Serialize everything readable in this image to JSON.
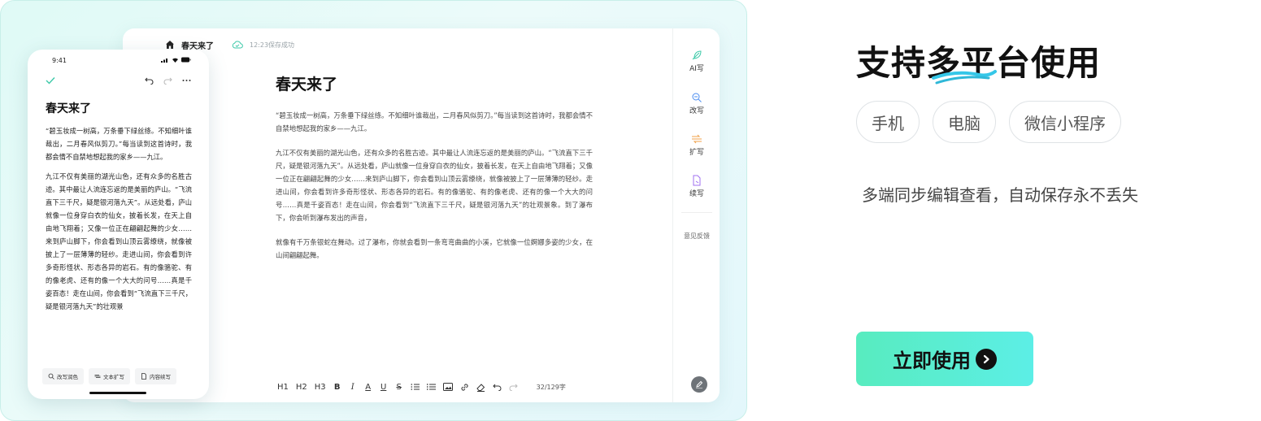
{
  "desktop": {
    "doc_name": "春天来了",
    "save_status": "12:23保存成功",
    "title": "春天来了",
    "paragraphs": [
      "“碧玉妆成一树高，万条垂下绿丝绦。不知细叶谁裁出，二月春风似剪刀。”每当读到这首诗时，我都会情不自禁地想起我的家乡——九江。",
      "九江不仅有美丽的湖光山色，还有众多的名胜古迹。其中最让人流连忘返的是美丽的庐山。“飞流直下三千尺，疑是银河落九天”。从远处看，庐山就像一位身穿白衣的仙女，披着长发，在天上自由地飞翔着；又像一位正在翩翩起舞的少女……来到庐山脚下，你会看到山顶云雾缭绕，就像被披上了一层薄薄的轻纱。走进山间，你会看到许多奇形怪状、形态各异的岩石。有的像骆驼、有的像老虎、还有的像一个大大的问号……真是千姿百态！走在山间，你会看到“飞流直下三千尺，疑是银河落九天”的壮观景象。到了瀑布下，你会听到瀑布发出的声音，",
      "就像有千万条银蛇在舞动。过了瀑布，你就会看到一条弯弯曲曲的小溪，它就像一位婀娜多姿的少女，在山间翩翩起舞。"
    ],
    "toolbar": [
      "H1",
      "H2",
      "H3",
      "B",
      "I",
      "A",
      "U",
      "S"
    ],
    "word_count": "32/129字",
    "rail": {
      "ai_write": "AI写",
      "rewrite": "改写",
      "expand": "扩写",
      "continue": "续写",
      "feedback": "意见反馈"
    }
  },
  "phone": {
    "time": "9:41",
    "title": "春天来了",
    "paragraphs": [
      "“碧玉妆成一树高，万条垂下绿丝绦。不知细叶谁裁出，二月春风似剪刀。”每当读到这首诗时，我都会情不自禁地想起我的家乡——九江。",
      "九江不仅有美丽的湖光山色，还有众多的名胜古迹。其中最让人流连忘返的是美丽的庐山。“飞流直下三千尺，疑是银河落九天”。从远处看，庐山就像一位身穿白衣的仙女，披着长发，在天上自由地飞翔着；又像一位正在翩翩起舞的少女……来到庐山脚下，你会看到山顶云雾缭绕，就像被披上了一层薄薄的轻纱。走进山间，你会看到许多奇形怪状、形态各异的岩石。有的像骆驼、有的像老虎、还有的像一个大大的问号……真是千姿百态！走在山间，你会看到“飞流直下三千尺，疑是银河落九天”的壮观景"
    ],
    "actions": [
      "改写润色",
      "文本扩写",
      "内容续写"
    ]
  },
  "marketing": {
    "headline": "支持多平台使用",
    "chips": [
      "手机",
      "电脑",
      "微信小程序"
    ],
    "subtitle": "多端同步编辑查看，自动保存永不丢失",
    "cta_label": "立即使用"
  }
}
